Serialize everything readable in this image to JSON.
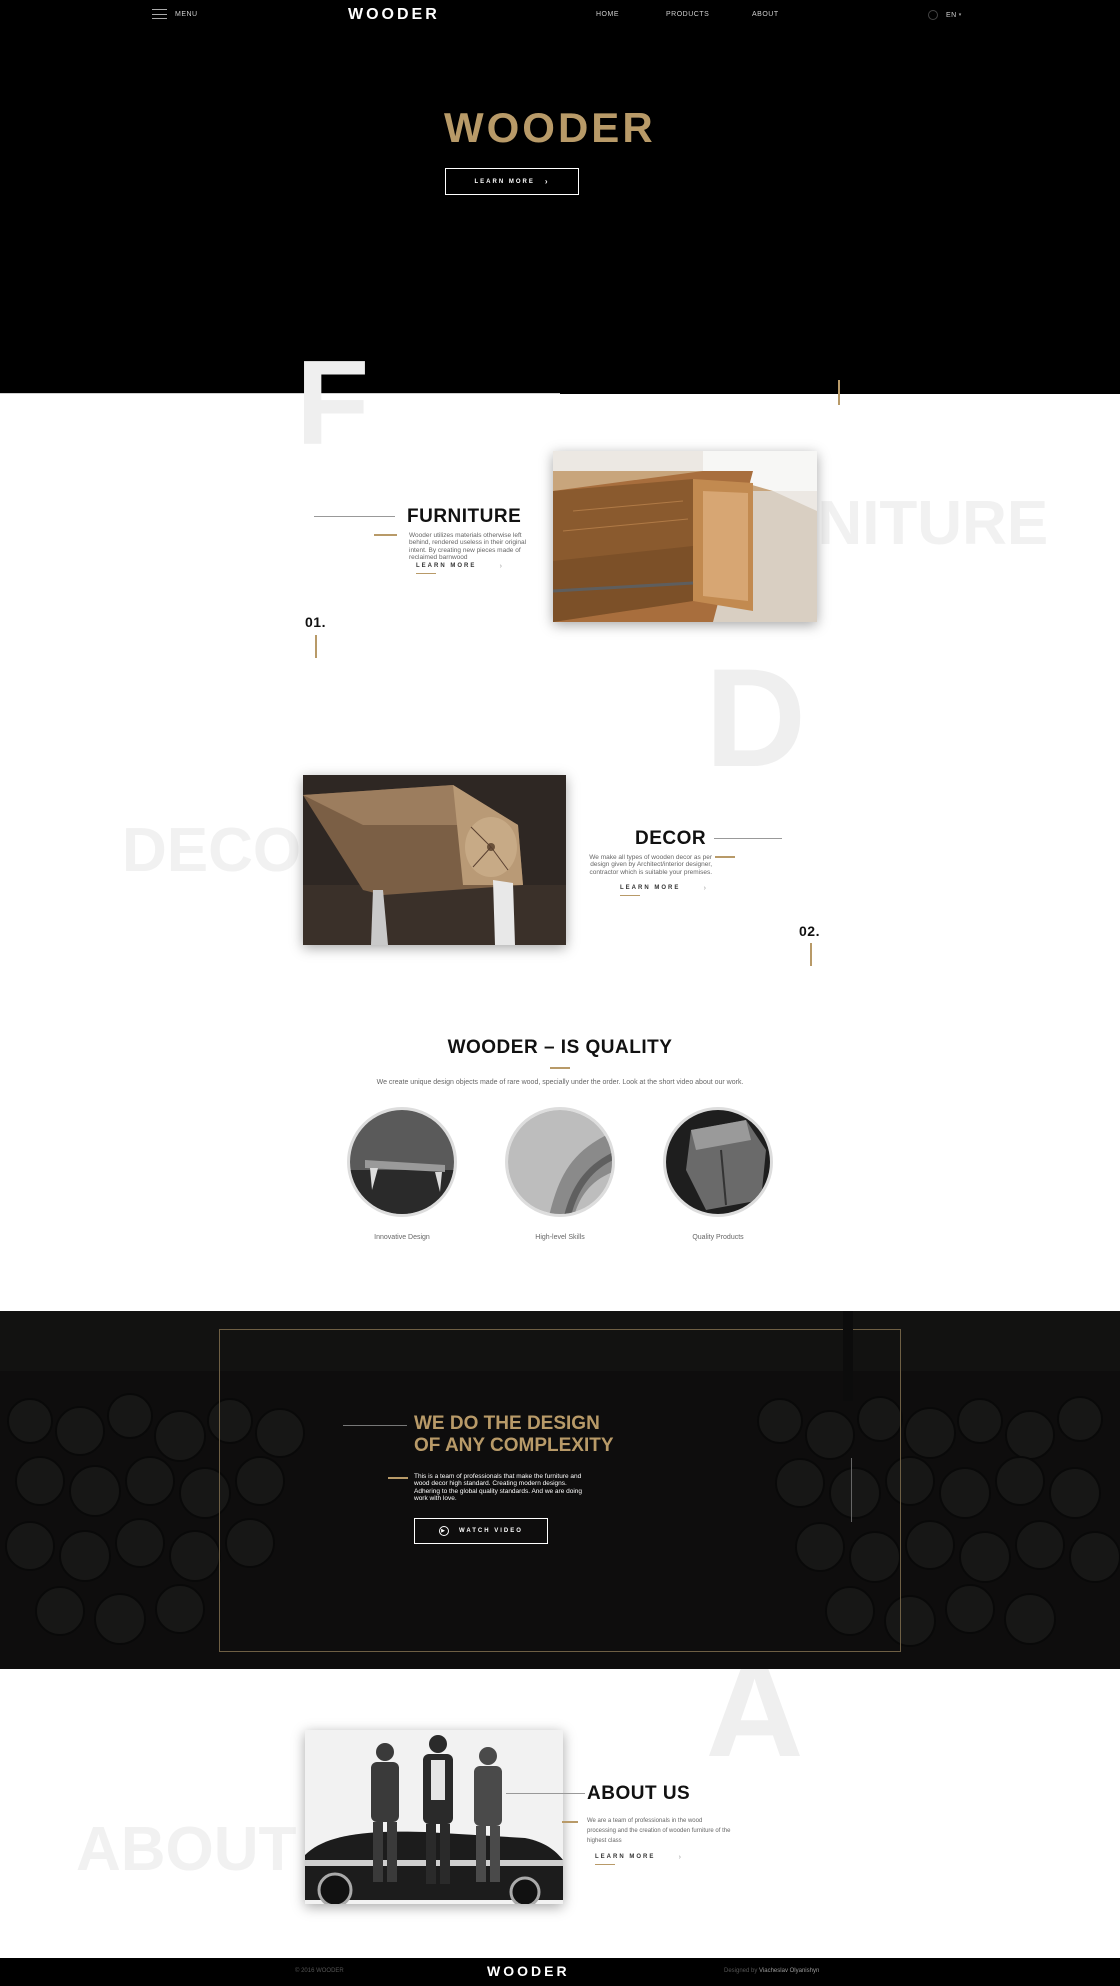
{
  "header": {
    "menu_label": "MENU",
    "logo": "WOODER",
    "nav": [
      "HOME",
      "PRODUCTS",
      "ABOUT"
    ],
    "lang": "EN"
  },
  "hero": {
    "title": "WOODER",
    "button": "LEARN MORE"
  },
  "furniture": {
    "ghost_letter": "F",
    "ghost_word": "FURNITURE",
    "title": "FURNITURE",
    "text": "Wooder utilizes materials otherwise left behind, rendered useless in their original intent. By creating new pieces made of reclaimed barnwood",
    "learn": "LEARN MORE",
    "number": "01."
  },
  "decor": {
    "ghost_letter": "D",
    "ghost_word": "DECOR",
    "title": "DECOR",
    "text": "We make all types of wooden decor as per design given by Architect/interior designer, contractor which is suitable your premises.",
    "learn": "LEARN MORE",
    "number": "02."
  },
  "quality": {
    "title": "WOODER – IS QUALITY",
    "text": "We create unique design objects made of rare wood, specially under the order. Look at the short video about our work.",
    "items": [
      {
        "label": "Innovative Design"
      },
      {
        "label": "High-level Skills"
      },
      {
        "label": "Quality Products"
      }
    ]
  },
  "design": {
    "title_line1": "WE DO THE DESIGN",
    "title_line2": "OF ANY COMPLEXITY",
    "text": "This is a team of professionals that make the furniture and wood decor high standard. Creating modern designs. Adhering to the global quality standards. And we are doing work with love.",
    "button": "WATCH VIDEO"
  },
  "about": {
    "ghost_letter": "A",
    "ghost_word": "ABOUT",
    "title": "ABOUT US",
    "text": "We are a team of professionals in the wood processing and the creation of wooden furniture of the highest class",
    "learn": "LEARN MORE"
  },
  "footer": {
    "copyright": "© 2016 WOODER",
    "logo": "WOODER",
    "credit_prefix": "Designed by",
    "credit_name": "Viacheslav Olyanishyn"
  },
  "colors": {
    "accent": "#b89a68",
    "dark": "#000000"
  }
}
